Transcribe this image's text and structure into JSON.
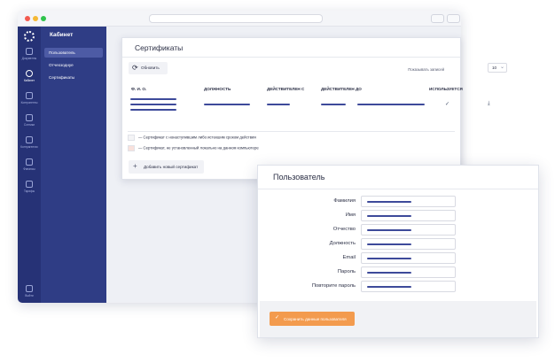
{
  "app": {
    "title": "Кабинет"
  },
  "rail": [
    {
      "label": "Документы",
      "icon": "document-icon"
    },
    {
      "label": "Кабинет",
      "icon": "user-icon",
      "active": true
    },
    {
      "label": "Контрагенты",
      "icon": "briefcase-icon"
    },
    {
      "label": "Сотники",
      "icon": "box-icon"
    },
    {
      "label": "Контрагентах",
      "icon": "calendar-icon"
    },
    {
      "label": "Финансы",
      "icon": "wallet-icon"
    },
    {
      "label": "Тарифы",
      "icon": "card-icon"
    }
  ],
  "rail_bottom": {
    "label": "Выйти",
    "icon": "logout-icon"
  },
  "menu": [
    {
      "label": "Пользователь",
      "active": true
    },
    {
      "label": "Отчеозоднуе"
    },
    {
      "label": "Сертификаты"
    }
  ],
  "certificates": {
    "title": "Сертификаты",
    "refresh_label": "Обновить",
    "per_page_label": "Показывать записей",
    "per_page_value": "10",
    "columns": [
      "Ф. И. О.",
      "ДОЛЖНОСТЬ",
      "ДЕЙСТВИТЕЛЕН С",
      "ДЕЙСТВИТЕЛЕН ДО",
      "ИСПОЛЬЗУЕТСЯ"
    ],
    "legend": [
      {
        "text": "— Сертификат с нонаступившим либо истекшим сроком действия",
        "color": "#f4f4f6"
      },
      {
        "text": "— Сертификат, не установленный локально на данном компьютере",
        "color": "#f9e1dc"
      }
    ],
    "add_label": "Добавить новый сертификат"
  },
  "user": {
    "title": "Пользователь",
    "fields": [
      "Фамилия",
      "Имя",
      "Отчество",
      "Должность",
      "Email",
      "Пароль",
      "Повторите пароль"
    ],
    "save_label": "Сохранить данные пользователя"
  },
  "colors": {
    "sidebar_rail": "#263276",
    "sidebar_panel": "#2f3d85",
    "accent_line": "#3d4a9a",
    "save_button": "#f39b4e"
  }
}
